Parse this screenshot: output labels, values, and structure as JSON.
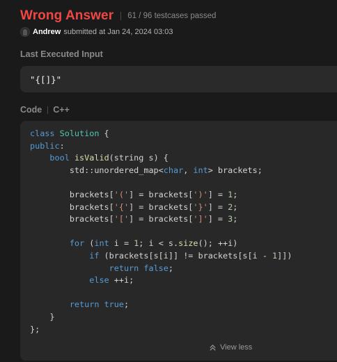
{
  "header": {
    "status": "Wrong Answer",
    "testcases": "61 / 96 testcases passed"
  },
  "submission": {
    "user": "Andrew",
    "submitted_text": "submitted at Jan 24, 2024 03:03"
  },
  "last_input": {
    "label": "Last Executed Input",
    "value": "\"{[]}\""
  },
  "code": {
    "label": "Code",
    "language": "C++",
    "lines": [
      "class Solution {",
      "public:",
      "    bool isValid(string s) {",
      "        std::unordered_map<char, int> brackets;",
      "",
      "        brackets['('] = brackets[')'] = 1;",
      "        brackets['{'] = brackets['}'] = 2;",
      "        brackets['['] = brackets[']'] = 3;",
      "",
      "        for (int i = 1; i < s.size(); ++i)",
      "            if (brackets[s[i]] != brackets[s[i - 1]])",
      "                return false;",
      "            else ++i;",
      "",
      "        return true;",
      "    }",
      "};"
    ]
  },
  "view_less_label": "View less",
  "colors": {
    "status": "#ef4743",
    "background": "#1a1a1a",
    "panel": "#282828",
    "keyword": "#569cd6",
    "type": "#4ec9b0",
    "function": "#dcdcaa",
    "string": "#ce9178",
    "number": "#b5cea8"
  },
  "icons": {
    "avatar": "user-avatar",
    "view_less": "chevron-up-double-icon"
  }
}
